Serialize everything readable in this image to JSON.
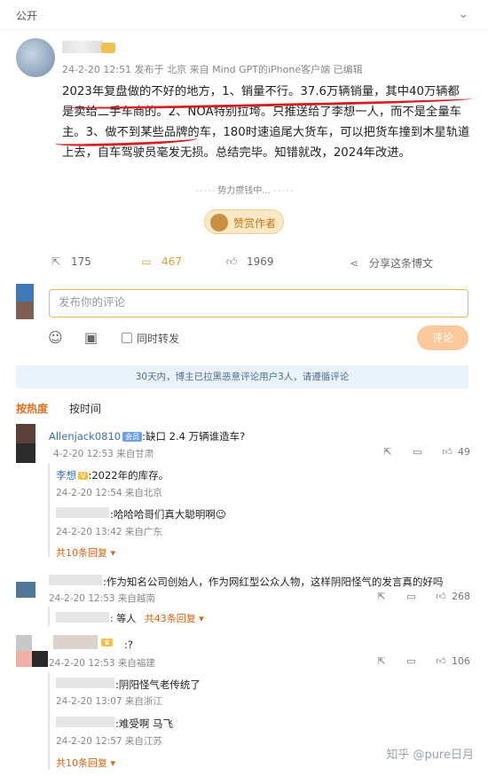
{
  "topbar": {
    "label": "公开",
    "chevron_icon": "chevron-down-icon"
  },
  "post": {
    "meta": "24-2-20 12:51  发布于 北京  来自 Mind GPT的iPhone客户端 已编辑",
    "body": "2023年复盘做的不好的地方，1、销量不行。37.6万辆销量，其中40万辆都是卖给二手车商的。2、NOA特别拉垮。只推送给了李想一人，而不是全量车主。3、做不到某些品牌的车，180时速追尾大货车，可以把货车撞到木星轨道上去，自车驾驶员毫发无损。总结完毕。知错就改，2024年改进。"
  },
  "thinking": "势力攒钱中...",
  "reward": {
    "label": "赞赏作者"
  },
  "actions": {
    "repost": "175",
    "comment": "467",
    "like": "1969",
    "share": "分享这条博文"
  },
  "composer": {
    "placeholder": "发布你的评论",
    "repost_label": "同时转发",
    "submit": "评论"
  },
  "notice": "30天内，博主已拉黑恶意评论用户3人，请遵循评论",
  "sort": {
    "hot": "按热度",
    "time": "按时间"
  },
  "comments": [
    {
      "name": "Allenjack0810",
      "badge": "会员",
      "text": ":缺口 2.4 万辆谁造车?",
      "meta": "4-2-20 12:53  来自甘肃",
      "likes": "49",
      "replies": [
        {
          "name": "李想",
          "badge": "V",
          "text": ":2022年的库存。",
          "meta": "24-2-20 12:54  来自北京"
        },
        {
          "name": "",
          "badge": "",
          "text": ":哈哈哈哥们真大聪明啊😉",
          "meta": "24-2-20 13:42  来自广东"
        }
      ],
      "more": "共10条回复 ▾"
    },
    {
      "name": "",
      "badge": "",
      "text": ":作为知名公司创始人，作为网红型公众人物，这样阴阳怪气的发言真的好吗",
      "meta": "24-2-20 12:53  来自越南",
      "likes": "268",
      "replies": [],
      "more_prefix": ": 等人",
      "more": "共43条回复 ▾"
    },
    {
      "name": "",
      "badge": "",
      "text": ":?",
      "meta": "24-2-20 12:53  来自福建",
      "likes": "106",
      "replies": [
        {
          "name": "",
          "badge": "",
          "text": ":阴阳怪气老传统了",
          "meta": "24-2-20 13:07  来自浙江"
        },
        {
          "name": "",
          "badge": "",
          "text": ":难受啊 马飞",
          "meta": "24-2-20 12:57  来自江苏"
        }
      ],
      "more": "共10条回复 ▾"
    }
  ],
  "watermark": "知乎 @pure日月"
}
